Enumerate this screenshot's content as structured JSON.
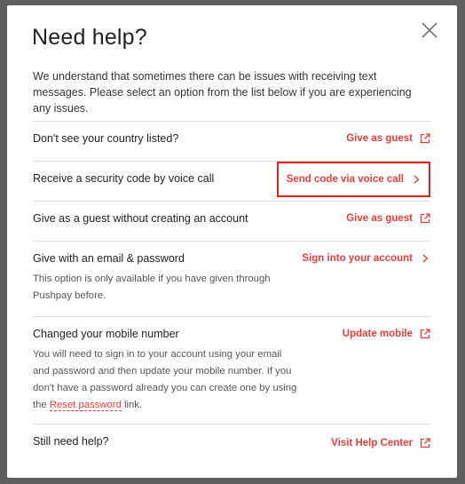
{
  "dialog": {
    "title": "Need help?",
    "intro": "We understand that sometimes there can be issues with receiving text messages. Please select an option from the list below if you are experiencing any issues."
  },
  "options": [
    {
      "label": "Don't see your country listed?",
      "action": "Give as guest",
      "icon": "external-link-icon"
    },
    {
      "label": "Receive a security code by voice call",
      "action": "Send code via voice call",
      "icon": "chevron-right-icon",
      "highlighted": true
    },
    {
      "label": "Give as a guest without creating an account",
      "action": "Give as guest",
      "icon": "external-link-icon"
    },
    {
      "label": "Give with an email & password",
      "description": "This option is only available if you have given through Pushpay before.",
      "action": "Sign into your account",
      "icon": "chevron-right-icon"
    },
    {
      "label": "Changed your mobile number",
      "description_before": "You will need to sign in to your account using your email and password and then update your mobile number. If you don't have a password already you can create one by using the",
      "description_link": "Reset password",
      "description_after": "link.",
      "action": "Update mobile",
      "icon": "external-link-icon"
    },
    {
      "label": "Still need help?",
      "action": "Visit Help Center",
      "icon": "external-link-icon"
    }
  ],
  "colors": {
    "accent": "#e2403d",
    "highlight_border": "#e8201a",
    "backdrop": "#5f5f5f"
  }
}
